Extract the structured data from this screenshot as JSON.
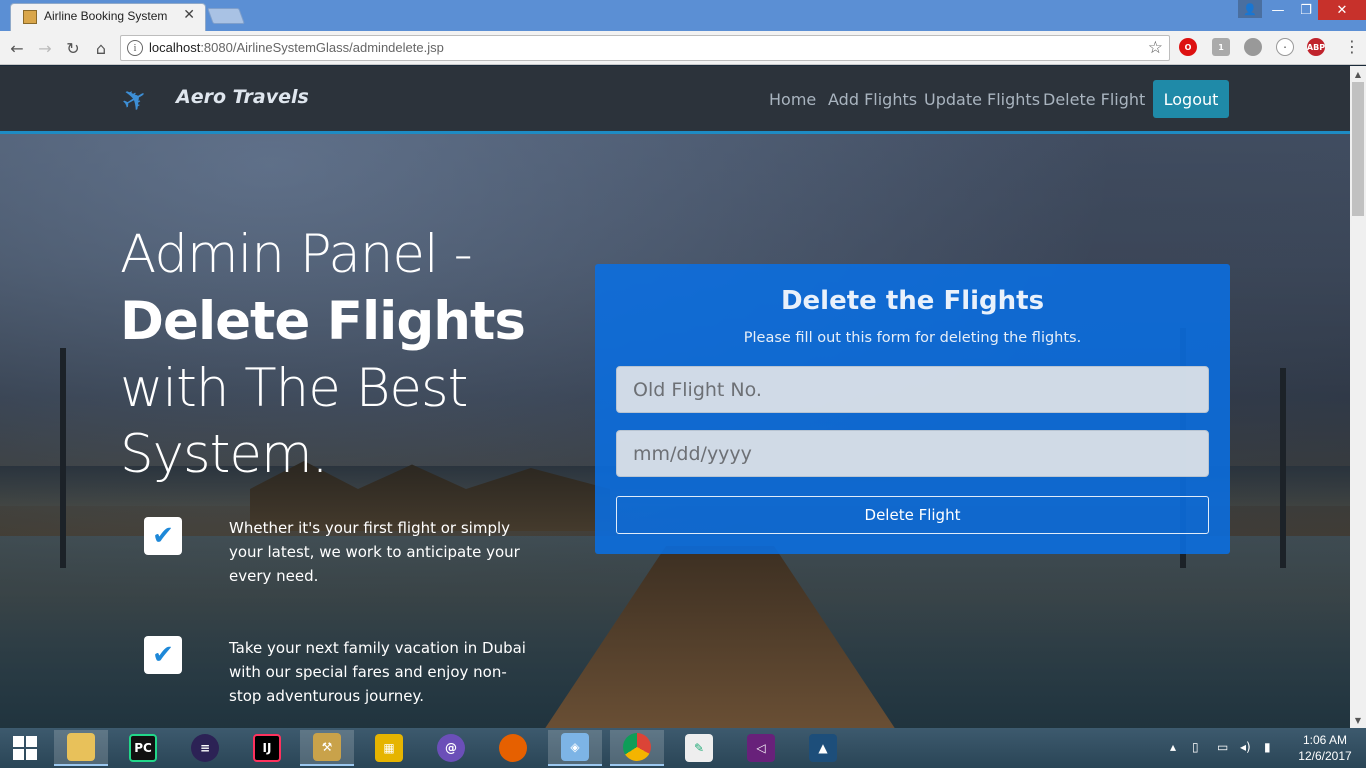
{
  "browser": {
    "tab_title": "Airline Booking System",
    "url_host": "localhost",
    "url_path": ":8080/AirlineSystemGlass/admindelete.jsp",
    "ext_badge": "1",
    "abp_label": "ABP"
  },
  "nav": {
    "brand": "Aero Travels",
    "links": [
      "Home",
      "Add Flights",
      "Update Flights",
      "Delete Flight"
    ],
    "logout": "Logout"
  },
  "hero": {
    "line1": "Admin Panel -",
    "line2": "Delete Flights",
    "line3": "with The Best",
    "line4": "System."
  },
  "features": [
    "Whether it's your first flight or simply your latest, we work to anticipate your every need.",
    "Take your next family vacation in Dubai with our special fares and enjoy non-stop adventurous journey."
  ],
  "form": {
    "title": "Delete the Flights",
    "subtitle": "Please fill out this form for deleting the flights.",
    "flight_placeholder": "Old Flight No.",
    "date_placeholder": "mm/dd/yyyy",
    "submit": "Delete Flight"
  },
  "taskbar": {
    "time": "1:06 AM",
    "date": "12/6/2017"
  },
  "colors": {
    "accent": "#1e8bc3",
    "form_bg": "#0a6ee1",
    "logout_bg": "#1f8aa8",
    "nav_bg": "#2c333b"
  }
}
